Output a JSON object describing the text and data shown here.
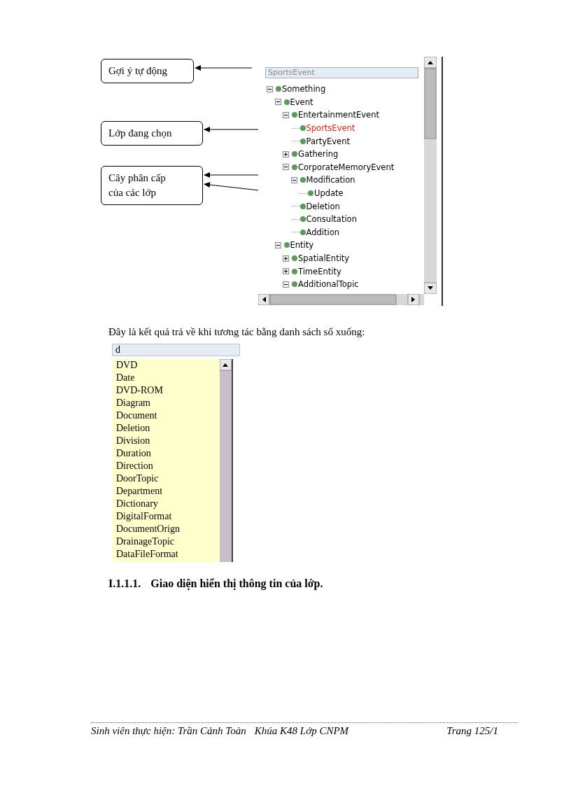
{
  "figure": {
    "callouts": [
      "Gợi ý tự động",
      "Lớp đang chọn",
      "Cây phân cấp\ncủa các lớp"
    ],
    "panel": {
      "search": {
        "value": "SportsEvent"
      },
      "tree": [
        {
          "name": "Something",
          "selected": false,
          "expanded": true,
          "children": [
            {
              "name": "Event",
              "selected": false,
              "expanded": true,
              "children": [
                {
                  "name": "EntertainmentEvent",
                  "selected": false,
                  "expanded": true,
                  "children": [
                    {
                      "name": "SportsEvent",
                      "selected": true
                    },
                    {
                      "name": "PartyEvent",
                      "selected": false
                    }
                  ]
                },
                {
                  "name": "Gathering",
                  "selected": false,
                  "expanded": false
                },
                {
                  "name": "CorporateMemoryEvent",
                  "selected": false,
                  "expanded": true,
                  "children": [
                    {
                      "name": "Modification",
                      "selected": false,
                      "expanded": true,
                      "children": [
                        {
                          "name": "Update",
                          "selected": false
                        }
                      ]
                    },
                    {
                      "name": "Deletion",
                      "selected": false
                    },
                    {
                      "name": "Consultation",
                      "selected": false
                    },
                    {
                      "name": "Addition",
                      "selected": false
                    }
                  ]
                }
              ]
            },
            {
              "name": "Entity",
              "selected": false,
              "expanded": true,
              "children": [
                {
                  "name": "SpatialEntity",
                  "selected": false,
                  "expanded": false
                },
                {
                  "name": "TimeEntity",
                  "selected": false,
                  "expanded": false
                },
                {
                  "name": "AdditionalTopic",
                  "selected": false,
                  "expanded": true
                }
              ]
            }
          ]
        }
      ]
    }
  },
  "paragraph": "Đây là kết quả trả về khi tương tác bằng danh sách sổ xuống:",
  "dropdown": {
    "field": {
      "value": "d"
    },
    "items": [
      "DVD",
      "Date",
      "DVD-ROM",
      "Diagram",
      "Document",
      "Deletion",
      "Division",
      "Duration",
      "Direction",
      "DoorTopic",
      "Department",
      "Dictionary",
      "DigitalFormat",
      "DocumentOrign",
      "DrainageTopic",
      "DataFileFormat"
    ]
  },
  "heading": {
    "number": "I.1.1.1.",
    "title": "Giao diện hiển thị thông tin của lớp."
  },
  "footer": {
    "author": "Sinh viên thực hiện: Trần Cảnh Toàn",
    "class": "Khúa K48 Lớp CNPM",
    "page": "Trang 125/1"
  }
}
